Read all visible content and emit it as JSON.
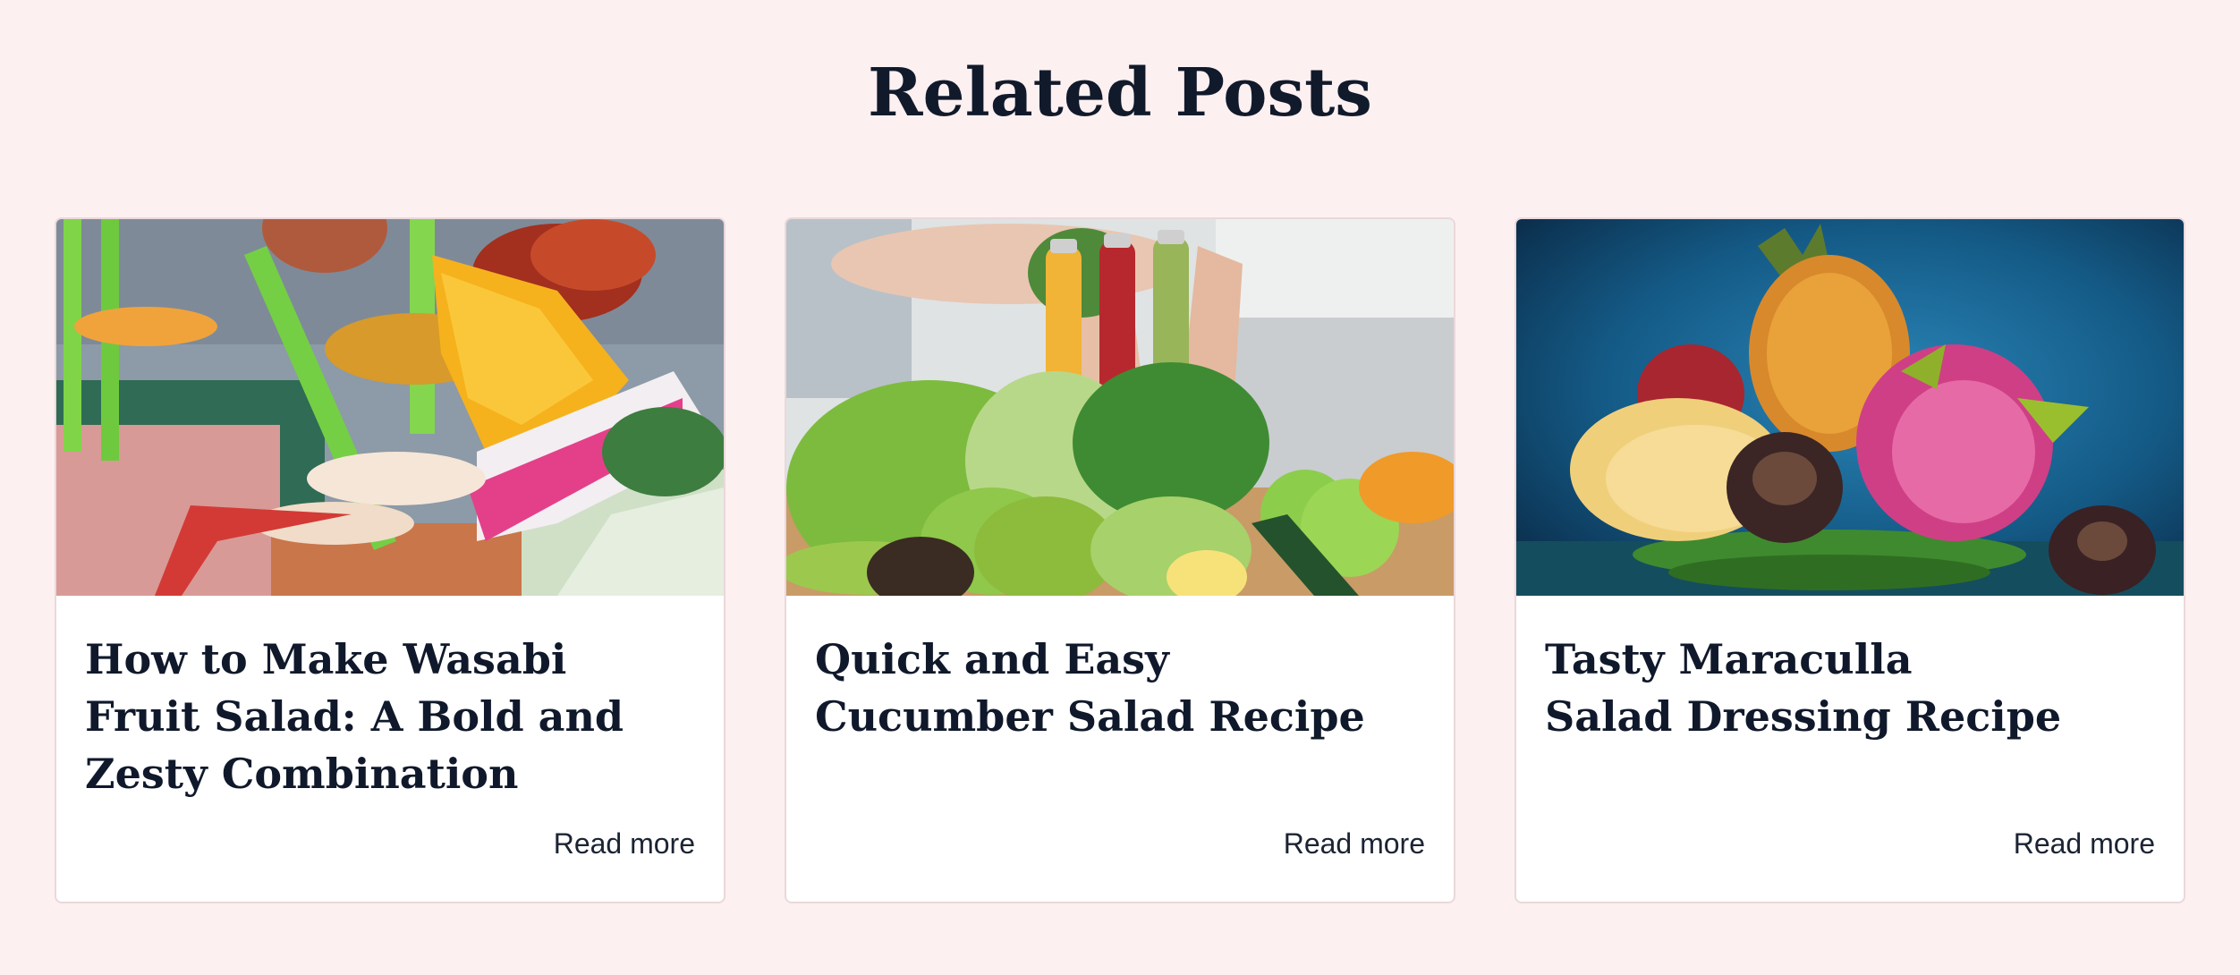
{
  "section": {
    "title": "Related Posts"
  },
  "posts": [
    {
      "title": "How to Make Wasabi\nFruit Salad: A Bold and\nZesty Combination",
      "read_more": "Read more",
      "image": "fruit-cocktail-photo"
    },
    {
      "title": "Quick and Easy\nCucumber Salad Recipe",
      "read_more": "Read more",
      "image": "vegetables-and-juice-bottles-photo"
    },
    {
      "title": "Tasty Maraculla\nSalad Dressing Recipe",
      "read_more": "Read more",
      "image": "exotic-fruit-plate-photo"
    }
  ],
  "colors": {
    "page_background": "#fdf0f1",
    "heading": "#111a2b",
    "card_border": "#ead8db"
  }
}
